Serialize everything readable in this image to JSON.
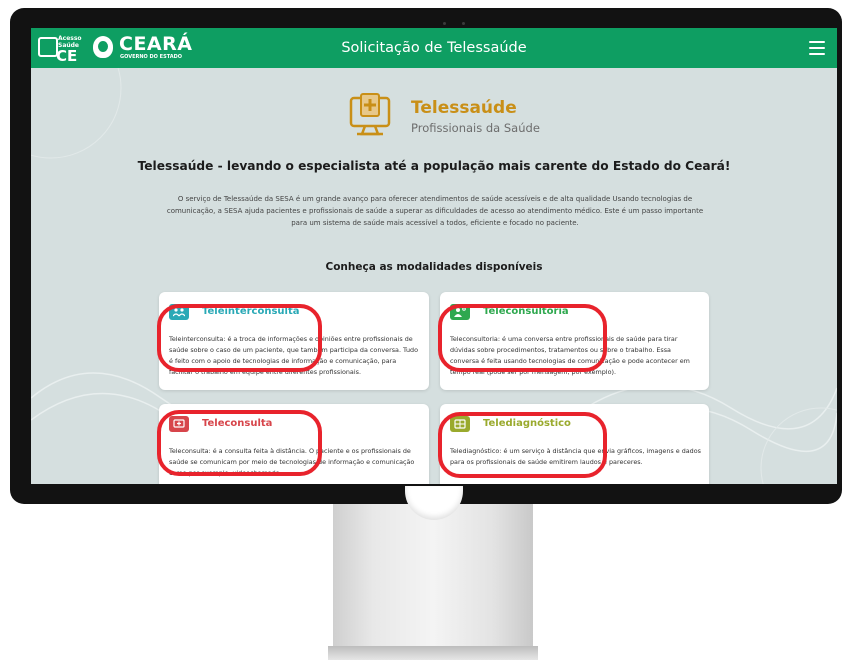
{
  "header": {
    "title": "Solicitação de Telessaúde",
    "logo_acesso_small": "Acesso Saúde",
    "logo_acesso_big": "CE",
    "logo_ceara": "CEARÁ",
    "logo_ceara_sub": "GOVERNO DO ESTADO",
    "menu_icon": "hamburger-menu-icon"
  },
  "hero": {
    "title": "Telessaúde",
    "subtitle": "Profissionais da Saúde",
    "icon": "medical-monitor-icon"
  },
  "headline": "Telessaúde - levando o especialista até a população mais carente do Estado do Ceará!",
  "intro": "O serviço de Telessaúde da SESA é um grande avanço para oferecer atendimentos de saúde acessíveis e de alta qualidade Usando tecnologias de comunicação, a SESA ajuda pacientes e profissionais de saúde a superar as dificuldades de acesso ao atendimento médico. Este é um passo importante para um sistema de saúde mais acessível a todos, eficiente e focado no paciente.",
  "section_title": "Conheça as modalidades disponíveis",
  "cards": [
    {
      "title": "Teleinterconsulta",
      "description": "Teleinterconsulta: é a troca de informações e opiniões entre profissionais de saúde sobre o caso de um paciente, que também participa da conversa. Tudo é feito com o apoio de tecnologias de informação e comunicação, para facilitar o trabalho em equipe entre diferentes profissionais.",
      "color": "#2aa9b6",
      "icon": "people-icon"
    },
    {
      "title": "Teleconsultoria",
      "description": "Teleconsultoria: é uma conversa entre profissionais de saúde para tirar dúvidas sobre procedimentos, tratamentos ou sobre o trabalho. Essa conversa é feita usando tecnologias de comunicação e pode acontecer em tempo real (pode ser por mensagem, por exemplo).",
      "color": "#2fa84f",
      "icon": "consultant-icon"
    },
    {
      "title": "Teleconsulta",
      "description": "Teleconsulta: é a consulta feita à distância. O paciente e os profissionais de saúde se comunicam por meio de tecnologias de informação e comunicação como por exemplo, videochamada.",
      "color": "#d7454b",
      "icon": "screen-plus-icon"
    },
    {
      "title": "Telediagnóstico",
      "description": "Telediagnóstico: é um serviço à distância que envia gráficos, imagens e dados para os profissionais de saúde emitirem laudos e pareceres.",
      "color": "#9aaa2d",
      "icon": "diagnostic-icon"
    }
  ],
  "colors": {
    "header_green": "#0e9e62",
    "page_background": "#d5dfdf",
    "highlight_ring": "#e8232c",
    "hero_gold": "#c98f17"
  }
}
